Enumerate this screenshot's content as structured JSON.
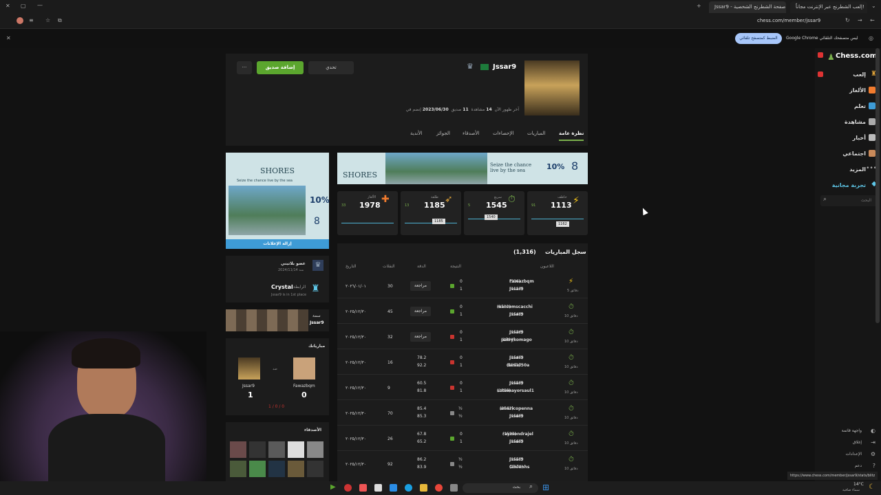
{
  "browser": {
    "tabs": [
      "إلعب الشطرنج عبر الإنترنت مجاناً!",
      "Jssar9 - صفحة الشطرنج الشخصية"
    ],
    "url": "chess.com/member/jssar9",
    "infobar_text": "Google Chrome ليس متصفحك التلقائي",
    "infobar_button": "الضبط كمتصفح تلقائي",
    "status_url": "https://www.chess.com/member/jssar9/stats/blitz"
  },
  "sidebar": {
    "logo": "Chess.com",
    "items": [
      {
        "label": "إلعب",
        "icon": "play-icon"
      },
      {
        "label": "الألغاز",
        "icon": "puzzle-icon"
      },
      {
        "label": "تعلم",
        "icon": "learn-icon"
      },
      {
        "label": "مشاهدة",
        "icon": "watch-icon"
      },
      {
        "label": "أخبار",
        "icon": "news-icon"
      },
      {
        "label": "اجتماعي",
        "icon": "social-icon"
      },
      {
        "label": "المزيد",
        "icon": "more-icon"
      },
      {
        "label": "تجربة مجانية",
        "icon": "diamond-icon"
      }
    ],
    "search_placeholder": "البحث",
    "bottom": [
      "واجهة قاتمة",
      "إغلاق",
      "الإعدادات",
      "دعم"
    ]
  },
  "profile": {
    "username": "Jssar9",
    "joined_label": "إنضم في",
    "joined": "2023/06/30",
    "friends": "11",
    "friends_label": "صديق",
    "views": "14",
    "views_label": "مشاهدة",
    "last_seen": "آخر ظهور الآن",
    "challenge": "تحدي",
    "add_friend": "إضافة صديق",
    "more": "···"
  },
  "tabs": [
    "نظرة عامة",
    "المباريات",
    "الإحصاءات",
    "الأصدقاء",
    "الجوائز",
    "الأندية"
  ],
  "ad": {
    "title": "SHORES",
    "sub": "Seize the chance live by the sea",
    "pct": "10%",
    "num": "8",
    "remove": "إزالة الإعلانات"
  },
  "ratings": [
    {
      "name": "خاطف",
      "value": "1113",
      "delta": "91",
      "chip": "1162",
      "color": "#f5c518"
    },
    {
      "name": "سريع",
      "value": "1545",
      "delta": "5",
      "chip": "1540",
      "color": "#7ab04c"
    },
    {
      "name": "طلقة",
      "value": "1185",
      "delta": "13",
      "chip": "1185",
      "color": "#e0a43a"
    },
    {
      "name": "الألغاز",
      "value": "1978",
      "delta": "33",
      "chip": "",
      "color": "#f17b2e"
    }
  ],
  "membership": {
    "label": "عضو بلاتيني",
    "since": "منذ 2024/11/14"
  },
  "league": {
    "label": "الرابطة",
    "name": "Crystal",
    "sub": "Jssar9 is in 1st place"
  },
  "theme": {
    "label": "سمة",
    "name": "Jssar9"
  },
  "match": {
    "title": "مبارياتك",
    "vs": "ضد",
    "p1": "Jssar9",
    "s1": "1",
    "p2": "Fawazbqm",
    "s2": "0",
    "record": "1 / 0 / 0"
  },
  "friends_title": "الأصدقاء",
  "games": {
    "title": "سجل المباريات",
    "count": "(1,316)",
    "headers": {
      "players": "اللاعبون",
      "result": "النتيجة",
      "accuracy": "الدقة",
      "moves": "النقلات",
      "date": "التاريخ"
    },
    "rows": [
      {
        "type": "blitz",
        "tc": "5 دقائق",
        "p1": "Fawazbqm",
        "r1": "(336)",
        "p2": "Jssar9",
        "r2": "(1113)",
        "sc1": "0",
        "sc2": "1",
        "win": true,
        "acc1": "مراجعة",
        "acc2": "",
        "moves": "30",
        "date": "٢٠٢٦/٠١/٠١"
      },
      {
        "type": "rapid",
        "tc": "10 دقائق",
        "p1": "marcomscacchi",
        "r1": "(1512)",
        "p2": "Jssar9",
        "r2": "(1545)",
        "sc1": "0",
        "sc2": "1",
        "win": true,
        "acc1": "مراجعة",
        "acc2": "",
        "moves": "45",
        "date": "٢٠٢٥/١٢/٣٠"
      },
      {
        "type": "rapid",
        "tc": "10 دقائق",
        "p1": "Jssar9",
        "r1": "(1536)",
        "p2": "patrykomago",
        "r2": "(1564)",
        "sc1": "0",
        "sc2": "1",
        "win": false,
        "acc1": "مراجعة",
        "acc2": "",
        "moves": "32",
        "date": "٢٠٢٥/١٢/٣٠"
      },
      {
        "type": "rapid",
        "tc": "10 دقائق",
        "p1": "Jssar9",
        "r1": "(1545)",
        "p2": "daniel50a",
        "r2": "(1551)",
        "sc1": "0",
        "sc2": "1",
        "win": false,
        "acc1": "78.2",
        "acc2": "92.2",
        "moves": "16",
        "date": "٢٠٢٥/١٢/٣٠"
      },
      {
        "type": "rapid",
        "tc": "10 دقائق",
        "p1": "Jssar9",
        "r1": "(1555)",
        "p2": "sotomayorsaul1",
        "r2": "(1555)",
        "sc1": "0",
        "sc2": "1",
        "win": false,
        "acc1": "60.5",
        "acc2": "81.8",
        "moves": "9",
        "date": "٢٠٢٥/١٢/٣٠"
      },
      {
        "type": "rapid",
        "tc": "10 دقائق",
        "p1": "americopenna",
        "r1": "(1562)",
        "p2": "Jssar9",
        "r2": "(1565)",
        "sc1": "½",
        "sc2": "½",
        "win": null,
        "acc1": "85.4",
        "acc2": "85.3",
        "moves": "70",
        "date": "٢٠٢٥/١٢/٣٠"
      },
      {
        "type": "rapid",
        "tc": "10 دقائق",
        "p1": "raymondrajel",
        "r1": "(1523)",
        "p2": "Jssar9",
        "r2": "(1565)",
        "sc1": "0",
        "sc2": "1",
        "win": true,
        "acc1": "67.8",
        "acc2": "65.2",
        "moves": "26",
        "date": "٢٠٢٥/١٢/٣٠"
      },
      {
        "type": "rapid",
        "tc": "10 دقائق",
        "p1": "Jssar9",
        "r1": "(1555)",
        "p2": "Ginlenhs",
        "r2": "(1570)",
        "sc1": "½",
        "sc2": "½",
        "win": null,
        "acc1": "86.2",
        "acc2": "83.9",
        "moves": "92",
        "date": "٢٠٢٥/١٢/٣٠"
      }
    ]
  },
  "taskbar": {
    "search": "بحث",
    "weather": "14°C",
    "weather_sub": "سماء صافية"
  },
  "colors": {
    "green": "#5ba62e",
    "win": "#5ba62e",
    "loss": "#c9342f",
    "draw": "#888888",
    "accent": "#3e9bd6"
  }
}
